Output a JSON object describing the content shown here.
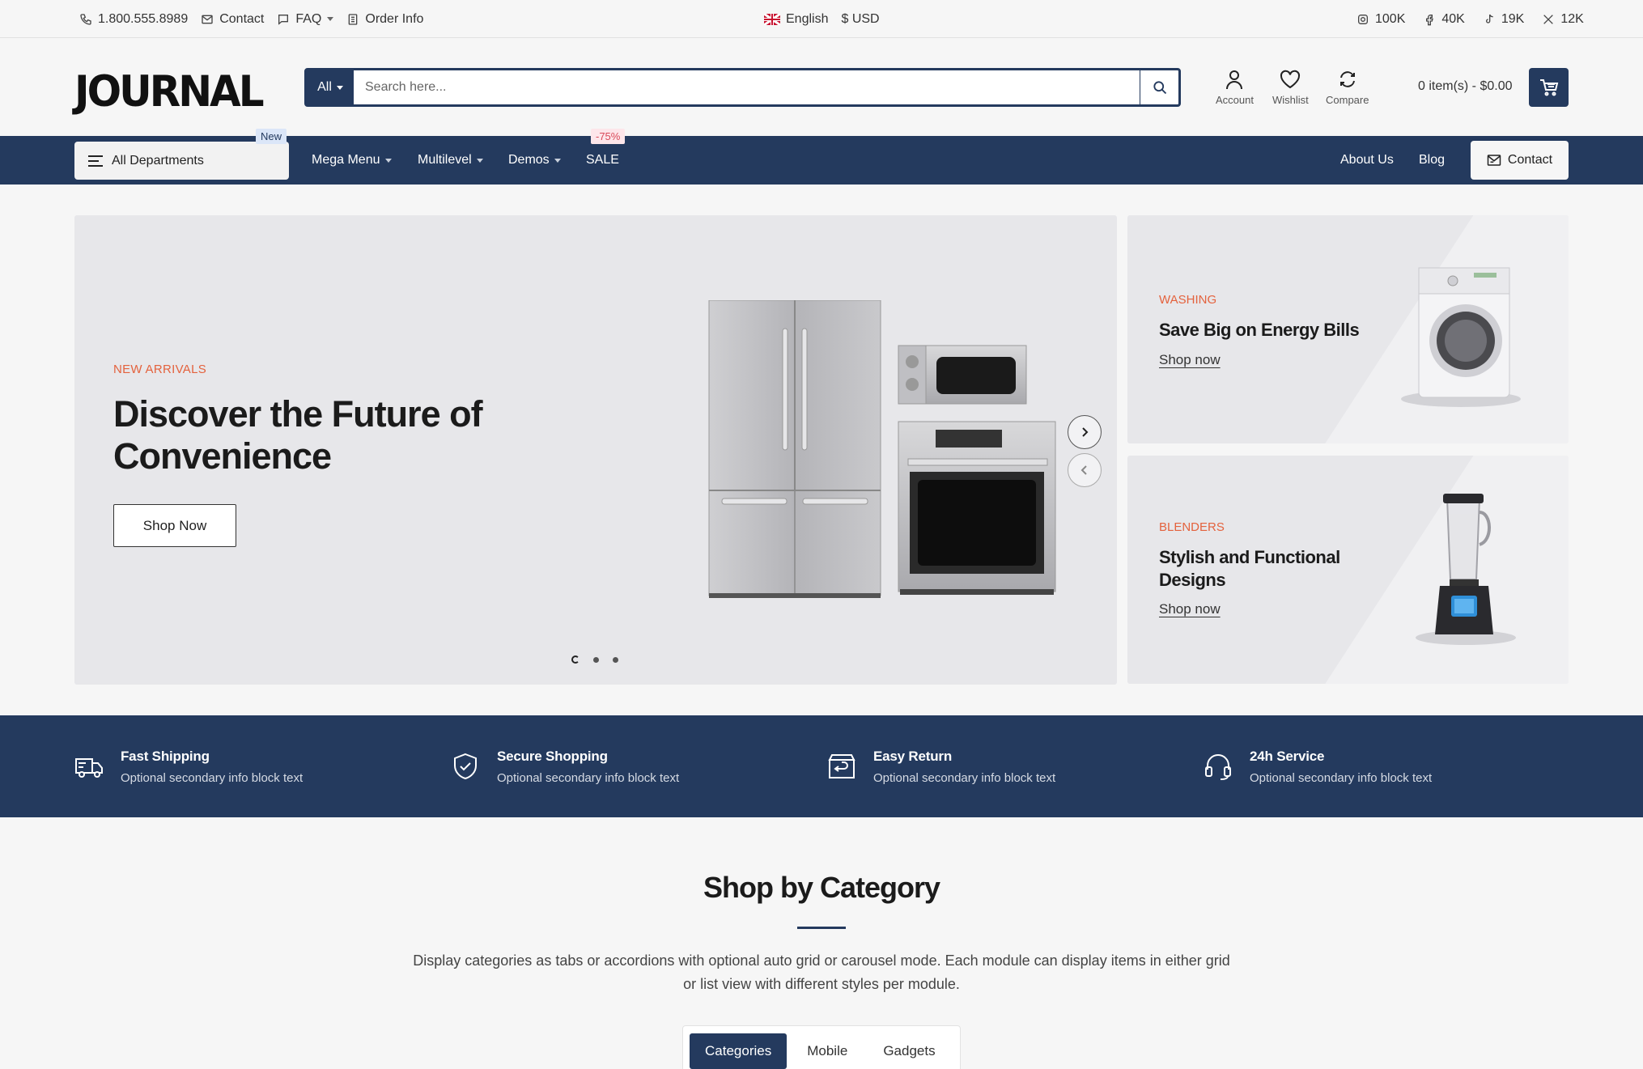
{
  "topbar": {
    "phone": "1.800.555.8989",
    "contact": "Contact",
    "faq": "FAQ",
    "order_info": "Order Info",
    "language": "English",
    "currency": "$ USD",
    "social": [
      {
        "icon": "instagram-icon",
        "count": "100K"
      },
      {
        "icon": "facebook-icon",
        "count": "40K"
      },
      {
        "icon": "tiktok-icon",
        "count": "19K"
      },
      {
        "icon": "x-icon",
        "count": "12K"
      }
    ]
  },
  "header": {
    "logo": "JOURNAL",
    "search_category": "All",
    "search_placeholder": "Search here...",
    "account": "Account",
    "wishlist": "Wishlist",
    "compare": "Compare",
    "cart": "0 item(s) - $0.00"
  },
  "nav": {
    "departments": "All Departments",
    "departments_badge": "New",
    "items": [
      "Mega Menu",
      "Multilevel",
      "Demos",
      "SALE"
    ],
    "sale_badge": "-75%",
    "about": "About Us",
    "blog": "Blog",
    "contact": "Contact"
  },
  "hero": {
    "eyebrow": "NEW ARRIVALS",
    "title": "Discover the Future of Convenience",
    "button": "Shop Now",
    "slide_index": 1,
    "slide_count": 3
  },
  "banners": [
    {
      "eyebrow": "WASHING",
      "title": "Save Big on Energy Bills",
      "link": "Shop now"
    },
    {
      "eyebrow": "BLENDERS",
      "title": "Stylish and Functional Designs",
      "link": "Shop now"
    }
  ],
  "features": [
    {
      "icon": "truck-icon",
      "title": "Fast Shipping",
      "text": "Optional secondary info block text"
    },
    {
      "icon": "shield-check-icon",
      "title": "Secure Shopping",
      "text": "Optional secondary info block text"
    },
    {
      "icon": "return-box-icon",
      "title": "Easy Return",
      "text": "Optional secondary info block text"
    },
    {
      "icon": "headset-icon",
      "title": "24h Service",
      "text": "Optional secondary info block text"
    }
  ],
  "categories": {
    "title": "Shop by Category",
    "description": "Display categories as tabs or accordions with optional auto grid or carousel mode. Each module can display items in either grid or list view with different styles per module.",
    "tabs": [
      "Categories",
      "Mobile",
      "Gadgets"
    ],
    "active_tab": "Categories"
  },
  "colors": {
    "navy": "#243a5e",
    "accent": "#e4623d",
    "background": "#f6f6f6"
  }
}
